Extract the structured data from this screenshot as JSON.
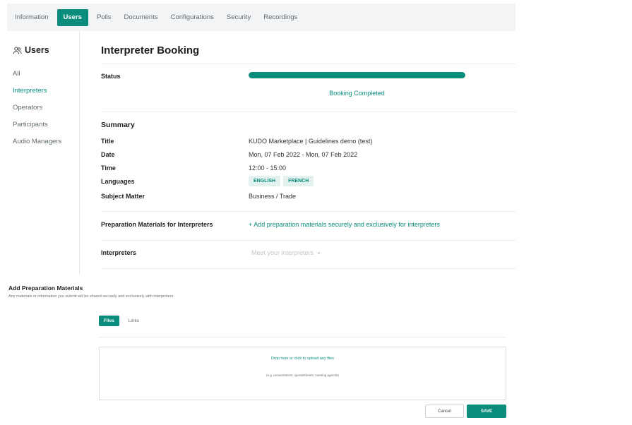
{
  "nav": {
    "tabs": [
      {
        "label": "Information",
        "active": false
      },
      {
        "label": "Users",
        "active": true
      },
      {
        "label": "Polls",
        "active": false
      },
      {
        "label": "Documents",
        "active": false
      },
      {
        "label": "Configurations",
        "active": false
      },
      {
        "label": "Security",
        "active": false
      },
      {
        "label": "Recordings",
        "active": false
      }
    ]
  },
  "sidebar": {
    "title": "Users",
    "icon": "users-icon",
    "items": [
      {
        "label": "All",
        "active": false
      },
      {
        "label": "Interpreters",
        "active": true
      },
      {
        "label": "Operators",
        "active": false
      },
      {
        "label": "Participants",
        "active": false
      },
      {
        "label": "Audio Managers",
        "active": false
      }
    ]
  },
  "booking": {
    "title": "Interpreter Booking",
    "status_label": "Status",
    "status_progress": 1.0,
    "status_text": "Booking Completed",
    "summary_heading": "Summary",
    "fields": {
      "title_label": "Title",
      "title_value": "KUDO Marketplace | Guidelines demo (test)",
      "date_label": "Date",
      "date_value": "Mon, 07 Feb 2022 - Mon, 07 Feb 2022",
      "time_label": "Time",
      "time_value": "12:00 - 15:00",
      "languages_label": "Languages",
      "languages": [
        "ENGLISH",
        "FRENCH"
      ],
      "subject_label": "Subject Matter",
      "subject_value": "Business / Trade"
    },
    "prep_label": "Preparation Materials for Interpreters",
    "prep_link": "+ Add preparation materials securely and exclusively for interpreters",
    "interpreters_label": "Interpreters",
    "interpreters_placeholder": "Meet your interpreters"
  },
  "prep": {
    "title": "Add Preparation Materials",
    "subtitle": "Any materials or information you submit will be shared securely and exclusively with interpreters.",
    "tabs": [
      {
        "label": "Files",
        "active": true
      },
      {
        "label": "Links",
        "active": false
      }
    ],
    "dropzone_main": "Drop here or click to upload any files",
    "dropzone_sub": "(e.g. presentations, spreadsheets, meeting agenda)",
    "cancel_label": "Cancel",
    "save_label": "SAVE"
  },
  "colors": {
    "accent": "#0a8d7c",
    "nav_bg": "#f3f4f5"
  }
}
